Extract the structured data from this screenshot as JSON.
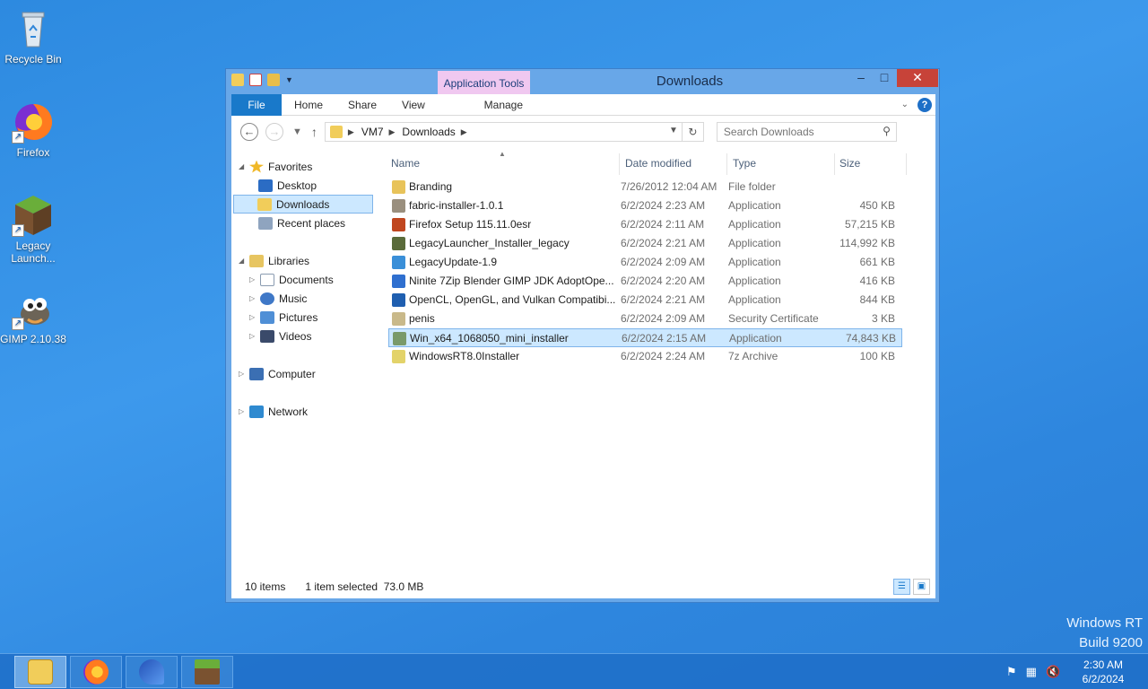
{
  "desktop": {
    "icons": [
      {
        "label": "Recycle Bin",
        "icon": "recycle-bin-icon"
      },
      {
        "label": "Firefox",
        "icon": "firefox-icon"
      },
      {
        "label": "Legacy Launch...",
        "icon": "minecraft-icon"
      },
      {
        "label": "GIMP 2.10.38",
        "icon": "gimp-icon"
      }
    ],
    "watermark_line1": "Windows RT",
    "watermark_line2": "Build 9200"
  },
  "window": {
    "title": "Downloads",
    "context_tab": "Application Tools",
    "ribbon_tabs": [
      "File",
      "Home",
      "Share",
      "View",
      "Manage"
    ],
    "address": {
      "segments": [
        "VM7",
        "Downloads"
      ]
    },
    "search": {
      "placeholder": "Search Downloads"
    },
    "nav": {
      "favorites": "Favorites",
      "desktop": "Desktop",
      "downloads": "Downloads",
      "recent": "Recent places",
      "libraries": "Libraries",
      "documents": "Documents",
      "music": "Music",
      "pictures": "Pictures",
      "videos": "Videos",
      "computer": "Computer",
      "network": "Network"
    },
    "columns": {
      "name": "Name",
      "date": "Date modified",
      "type": "Type",
      "size": "Size"
    },
    "files": [
      {
        "name": "Branding",
        "date": "7/26/2012 12:04 AM",
        "type": "File folder",
        "size": "",
        "color": "#e8c35a"
      },
      {
        "name": "fabric-installer-1.0.1",
        "date": "6/2/2024 2:23 AM",
        "type": "Application",
        "size": "450 KB",
        "color": "#9a8f7e"
      },
      {
        "name": "Firefox Setup 115.11.0esr",
        "date": "6/2/2024 2:11 AM",
        "type": "Application",
        "size": "57,215 KB",
        "color": "#c0461f"
      },
      {
        "name": "LegacyLauncher_Installer_legacy",
        "date": "6/2/2024 2:21 AM",
        "type": "Application",
        "size": "114,992 KB",
        "color": "#5a6b3a"
      },
      {
        "name": "LegacyUpdate-1.9",
        "date": "6/2/2024 2:09 AM",
        "type": "Application",
        "size": "661 KB",
        "color": "#3a8fd8"
      },
      {
        "name": "Ninite 7Zip Blender GIMP JDK AdoptOpe...",
        "date": "6/2/2024 2:20 AM",
        "type": "Application",
        "size": "416 KB",
        "color": "#2f6fcf"
      },
      {
        "name": "OpenCL, OpenGL, and Vulkan Compatibi...",
        "date": "6/2/2024 2:21 AM",
        "type": "Application",
        "size": "844 KB",
        "color": "#1f5fb0"
      },
      {
        "name": "penis",
        "date": "6/2/2024 2:09 AM",
        "type": "Security Certificate",
        "size": "3 KB",
        "color": "#c9b98a"
      },
      {
        "name": "Win_x64_1068050_mini_installer",
        "date": "6/2/2024 2:15 AM",
        "type": "Application",
        "size": "74,843 KB",
        "color": "#7a9a6a"
      },
      {
        "name": "WindowsRT8.0Installer",
        "date": "6/2/2024 2:24 AM",
        "type": "7z Archive",
        "size": "100 KB",
        "color": "#e3d36a"
      }
    ],
    "status": {
      "count": "10 items",
      "selection": "1 item selected  73.0 MB"
    }
  },
  "taskbar": {
    "apps": [
      "file-explorer",
      "firefox",
      "legacyupdate",
      "minecraft"
    ],
    "time": "2:30 AM",
    "date": "6/2/2024"
  }
}
